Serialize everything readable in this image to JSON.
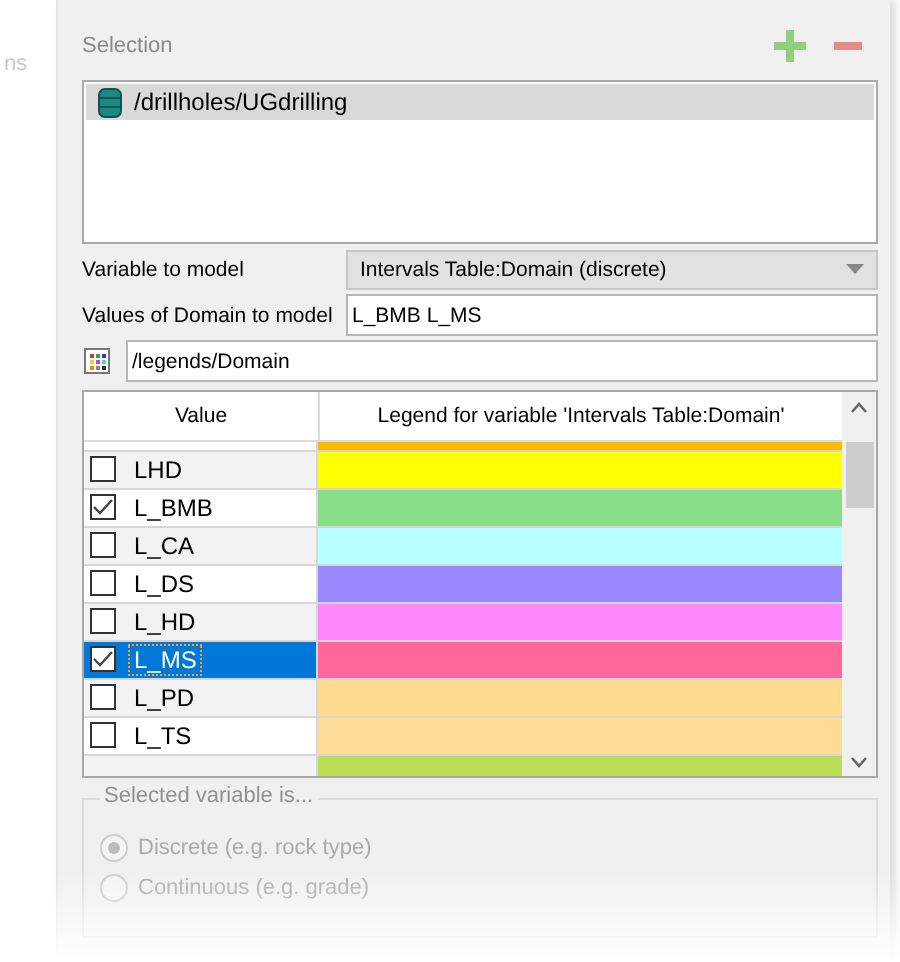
{
  "side_fragment": "ns",
  "selection": {
    "title": "Selection",
    "items": [
      {
        "label": "/drillholes/UGdrilling",
        "selected": true
      }
    ]
  },
  "variable_to_model": {
    "label": "Variable to model",
    "value": "Intervals Table:Domain (discrete)"
  },
  "values_to_model": {
    "label": "Values of Domain to model",
    "value": "L_BMB L_MS"
  },
  "legend_path": {
    "value": "/legends/Domain"
  },
  "table": {
    "columns": [
      "Value",
      "Legend for variable 'Intervals Table:Domain'"
    ],
    "rows": [
      {
        "selected": false,
        "color": "#ffb900"
      },
      {
        "label": "LHD",
        "checked": false,
        "selected": false,
        "color": "#ffff00"
      },
      {
        "label": "L_BMB",
        "checked": true,
        "selected": false,
        "color": "#88dd88"
      },
      {
        "label": "L_CA",
        "checked": false,
        "selected": false,
        "color": "#b8ffff"
      },
      {
        "label": "L_DS",
        "checked": false,
        "selected": false,
        "color": "#9988ff"
      },
      {
        "label": "L_HD",
        "checked": false,
        "selected": false,
        "color": "#ff88ff"
      },
      {
        "label": "L_MS",
        "checked": true,
        "selected": true,
        "color": "#ff6699"
      },
      {
        "label": "L_PD",
        "checked": false,
        "selected": false,
        "color": "#ffdb8f"
      },
      {
        "label": "L_TS",
        "checked": false,
        "selected": false,
        "color": "#ffdb96"
      },
      {
        "selected": false,
        "color": "#bbdd55"
      }
    ]
  },
  "variable_type": {
    "title": "Selected variable is...",
    "options": [
      {
        "label": "Discrete (e.g. rock type)",
        "selected": true,
        "disabled": true
      },
      {
        "label": "Continuous (e.g. grade)",
        "selected": false,
        "disabled": true
      }
    ]
  }
}
